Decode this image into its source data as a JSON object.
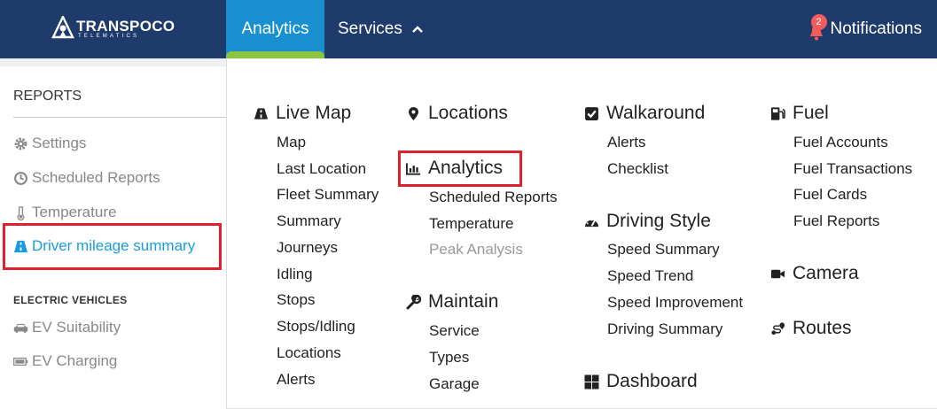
{
  "topbar": {
    "logo_text": "TRANSPOCO",
    "logo_sub": "TELEMATICS",
    "tabs": [
      {
        "label": "Analytics",
        "active": true
      },
      {
        "label": "Services",
        "expanded": true
      }
    ],
    "notifications": {
      "label": "Notifications",
      "count": "2"
    }
  },
  "colors": {
    "topbar": "#1f3b6b",
    "active_tab": "#1a8fd0",
    "active_tab_underline": "#8cc63f",
    "link_active": "#1a9be0",
    "highlight": "#e0202a",
    "badge": "#f05b5b"
  },
  "sidebar": {
    "heading": "REPORTS",
    "items": [
      {
        "label": "Settings",
        "icon": "gear-icon"
      },
      {
        "label": "Scheduled Reports",
        "icon": "clock-icon"
      },
      {
        "label": "Temperature",
        "icon": "thermometer-icon"
      },
      {
        "label": "Driver mileage summary",
        "icon": "road-icon",
        "active": true
      }
    ],
    "ev_heading": "ELECTRIC VEHICLES",
    "ev_items": [
      {
        "label": "EV Suitability",
        "icon": "car-icon"
      },
      {
        "label": "EV Charging",
        "icon": "battery-icon"
      }
    ]
  },
  "menu": {
    "live_map": {
      "title": "Live Map",
      "icon": "road-icon",
      "items": [
        "Map",
        "Last Location",
        "Fleet Summary",
        "Summary",
        "Journeys",
        "Idling",
        "Stops",
        "Stops/Idling",
        "Locations",
        "Alerts"
      ]
    },
    "locations": {
      "title": "Locations",
      "icon": "map-marker-icon"
    },
    "analytics": {
      "title": "Analytics",
      "icon": "bar-chart-icon",
      "items": [
        "Scheduled Reports",
        "Temperature",
        "Peak Analysis"
      ]
    },
    "maintain": {
      "title": "Maintain",
      "icon": "wrench-icon",
      "items": [
        "Service",
        "Types",
        "Garage"
      ]
    },
    "walkaround": {
      "title": "Walkaround",
      "icon": "checkbox-icon",
      "items": [
        "Alerts",
        "Checklist"
      ]
    },
    "driving_style": {
      "title": "Driving Style",
      "icon": "gauge-icon",
      "items": [
        "Speed Summary",
        "Speed Trend",
        "Speed Improvement",
        "Driving Summary"
      ]
    },
    "dashboard": {
      "title": "Dashboard",
      "icon": "grid-icon"
    },
    "fuel": {
      "title": "Fuel",
      "icon": "fuel-pump-icon",
      "items": [
        "Fuel Accounts",
        "Fuel Transactions",
        "Fuel Cards",
        "Fuel Reports"
      ]
    },
    "camera": {
      "title": "Camera",
      "icon": "video-camera-icon"
    },
    "routes": {
      "title": "Routes",
      "icon": "route-icon"
    }
  }
}
